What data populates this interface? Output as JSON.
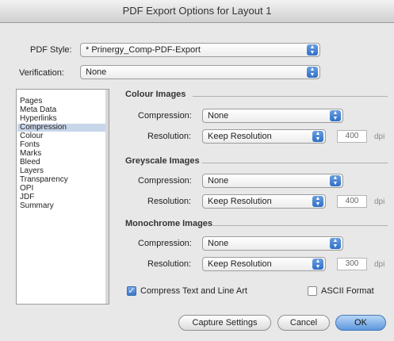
{
  "window": {
    "title": "PDF Export Options for Layout 1"
  },
  "pdf_style": {
    "label": "PDF Style:",
    "value": "* Prinergy_Comp-PDF-Export"
  },
  "verification": {
    "label": "Verification:",
    "value": "None"
  },
  "sidebar": {
    "items": [
      {
        "label": "Pages"
      },
      {
        "label": "Meta Data"
      },
      {
        "label": "Hyperlinks"
      },
      {
        "label": "Compression"
      },
      {
        "label": "Colour"
      },
      {
        "label": "Fonts"
      },
      {
        "label": "Marks"
      },
      {
        "label": "Bleed"
      },
      {
        "label": "Layers"
      },
      {
        "label": "Transparency"
      },
      {
        "label": "OPI"
      },
      {
        "label": "JDF"
      },
      {
        "label": "Summary"
      }
    ],
    "selected": "Compression"
  },
  "colour_images": {
    "title": "Colour Images",
    "compression_label": "Compression:",
    "compression_value": "None",
    "resolution_label": "Resolution:",
    "resolution_value": "Keep Resolution",
    "dpi_value": "400",
    "dpi_unit": "dpi"
  },
  "greyscale_images": {
    "title": "Greyscale Images",
    "compression_label": "Compression:",
    "compression_value": "None",
    "resolution_label": "Resolution:",
    "resolution_value": "Keep Resolution",
    "dpi_value": "400",
    "dpi_unit": "dpi"
  },
  "monochrome_images": {
    "title": "Monochrome Images",
    "compression_label": "Compression:",
    "compression_value": "None",
    "resolution_label": "Resolution:",
    "resolution_value": "Keep Resolution",
    "dpi_value": "300",
    "dpi_unit": "dpi"
  },
  "options": {
    "compress_text_label": "Compress Text and Line Art",
    "compress_text_checked": true,
    "ascii_label": "ASCII Format",
    "ascii_checked": false
  },
  "buttons": {
    "capture": "Capture Settings",
    "cancel": "Cancel",
    "ok": "OK"
  },
  "colors": {
    "accent": "#3a76c8",
    "selection": "#c8d6ea"
  }
}
